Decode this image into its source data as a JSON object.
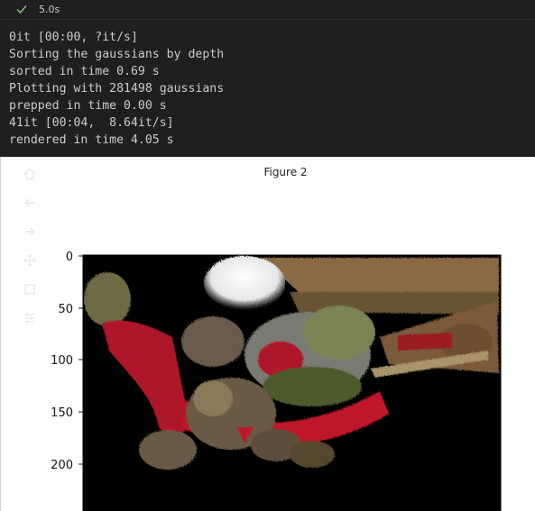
{
  "status": {
    "duration": "5.0s",
    "icon": "check-icon",
    "icon_color": "#89d185"
  },
  "output": {
    "lines": [
      "0it [00:00, ?it/s]",
      "Sorting the gaussians by depth",
      "sorted in time 0.69 s",
      "Plotting with 281498 gaussians",
      "prepped in time 0.00 s",
      "41it [00:04,  8.64it/s]",
      "rendered in time 4.05 s"
    ]
  },
  "figure": {
    "title": "Figure 2",
    "toolbar": [
      {
        "name": "home-icon"
      },
      {
        "name": "back-icon"
      },
      {
        "name": "forward-icon"
      },
      {
        "name": "pan-icon"
      },
      {
        "name": "zoom-icon"
      },
      {
        "name": "configure-icon"
      }
    ],
    "y_ticks": [
      "0",
      "50",
      "100",
      "150",
      "200"
    ]
  }
}
